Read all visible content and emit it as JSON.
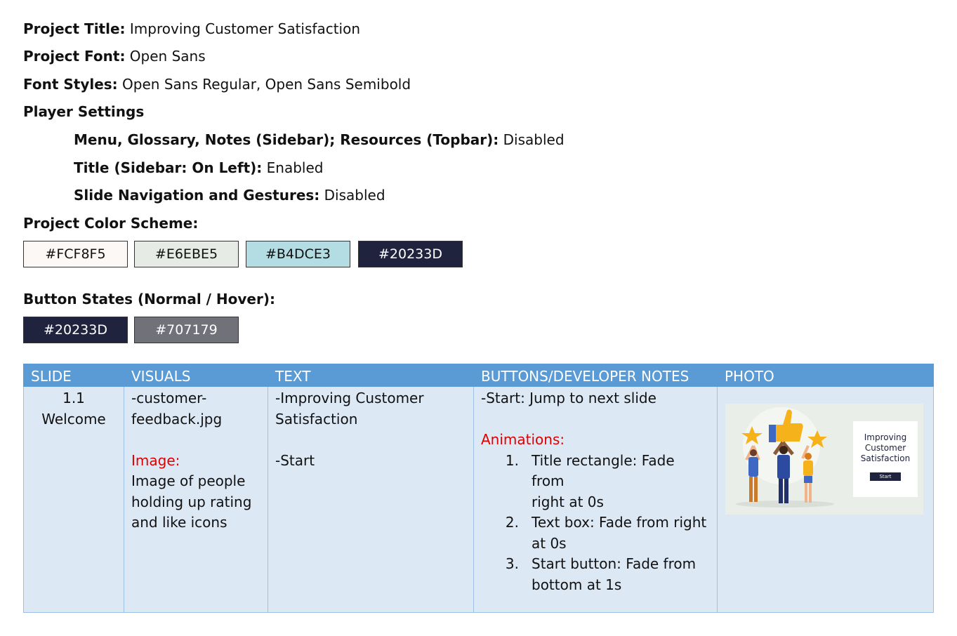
{
  "project": {
    "title_label": "Project Title:",
    "title_value": " Improving Customer Satisfaction",
    "font_label": "Project Font:",
    "font_value": " Open Sans",
    "styles_label": "Font Styles:",
    "styles_value": " Open Sans Regular, Open Sans Semibold",
    "player_settings_label": "Player Settings"
  },
  "player_settings": [
    {
      "label": "Menu, Glossary, Notes (Sidebar); Resources (Topbar):",
      "value": " Disabled"
    },
    {
      "label": "Title (Sidebar: On Left):",
      "value": " Enabled"
    },
    {
      "label": "Slide Navigation and Gestures:",
      "value": " Disabled"
    }
  ],
  "color_scheme": {
    "label": "Project Color Scheme:",
    "swatches": [
      {
        "text": "#FCF8F5",
        "bg": "#FCF8F5",
        "fg": "#111111"
      },
      {
        "text": "#E6EBE5",
        "bg": "#E6EBE5",
        "fg": "#111111"
      },
      {
        "text": "#B4DCE3",
        "bg": "#B4DCE3",
        "fg": "#111111"
      },
      {
        "text": "#20233D",
        "bg": "#20233D",
        "fg": "#FFFFFF"
      }
    ]
  },
  "button_states": {
    "label": "Button States (Normal / Hover):",
    "swatches": [
      {
        "text": "#20233D",
        "bg": "#20233D",
        "fg": "#FFFFFF"
      },
      {
        "text": "#707179",
        "bg": "#707179",
        "fg": "#FFFFFF"
      }
    ]
  },
  "table": {
    "headers": [
      "SLIDE",
      "VISUALS",
      "TEXT",
      "BUTTONS/DEVELOPER NOTES",
      "PHOTO"
    ],
    "header_bg": "#5B9BD5",
    "row": {
      "slide_number": "1.1",
      "slide_name": "Welcome",
      "visuals_file_line1": "-customer-",
      "visuals_file_line2": "feedback.jpg",
      "visuals_image_label": "Image:",
      "visuals_image_desc": [
        "Image of people",
        "holding up rating",
        "and like icons"
      ],
      "text_line1": "-Improving Customer",
      "text_line2": "Satisfaction",
      "text_start": "-Start",
      "notes_start": "-Start: Jump to next slide",
      "animations_label": "Animations:",
      "animations": [
        {
          "num": "1.",
          "lines": [
            "Title rectangle: Fade from",
            "right at 0s"
          ]
        },
        {
          "num": "2.",
          "lines": [
            "Text box: Fade from right",
            "at 0s"
          ]
        },
        {
          "num": "3.",
          "lines": [
            "Start button: Fade from",
            "bottom at 1s"
          ]
        }
      ]
    }
  },
  "photo": {
    "card_title_lines": [
      "Improving",
      "Customer",
      "Satisfaction"
    ],
    "button_label": "Start"
  }
}
